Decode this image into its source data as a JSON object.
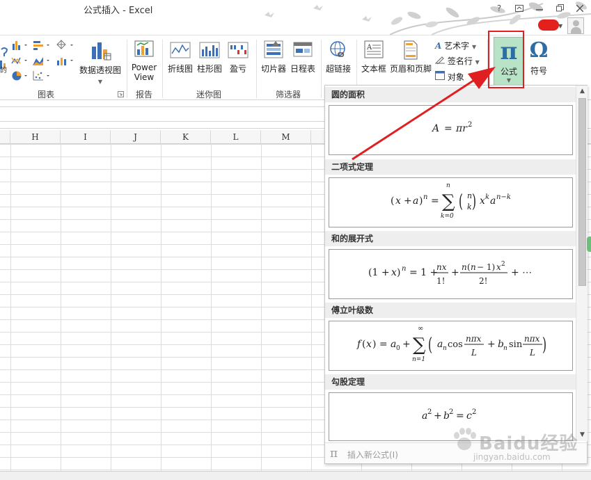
{
  "window": {
    "title": "公式插入 - Excel",
    "help": "?",
    "left_stub": "的"
  },
  "ribbon": {
    "groups": {
      "charts": "图表",
      "reports": "报告",
      "sparklines": "迷你图",
      "filters": "筛选器"
    },
    "buttons": {
      "pivot_chart": "数据透视图",
      "power_view_1": "Power",
      "power_view_2": "View",
      "line": "折线图",
      "column": "柱形图",
      "win_loss": "盈亏",
      "slicer": "切片器",
      "timeline": "日程表",
      "hyperlink": "超链接",
      "text_box": "文本框",
      "header_footer": "页眉和页脚",
      "wordart": "艺术字",
      "signature": "签名行",
      "object": "对象",
      "equation": "公式",
      "symbol": "符号"
    }
  },
  "sheet": {
    "columns": [
      "H",
      "I",
      "J",
      "K",
      "L",
      "M"
    ]
  },
  "gallery": {
    "sections": [
      {
        "title": "圆的面积",
        "formula": "A = πr²"
      },
      {
        "title": "二项式定理",
        "formula": "(x + a)ⁿ = Σ_{k=0}^{n} (n k) xᵏ aⁿ⁻ᵏ"
      },
      {
        "title": "和的展开式",
        "formula": "(1 + x)ⁿ = 1 + nx/1! + n(n − 1)x²/2! + ⋯"
      },
      {
        "title": "傅立叶级数",
        "formula": "f(x) = a₀ + Σ_{n=1}^{∞} (aₙ cos nπx/L + bₙ sin nπx/L)"
      },
      {
        "title": "勾股定理",
        "formula": "a² + b² = c²"
      }
    ],
    "insert_new": "插入新公式(I)"
  },
  "watermark": {
    "brand": "Baidu经验",
    "url": "jingyan.baidu.com"
  },
  "colors": {
    "highlight": "#e02020",
    "equation_button_bg": "#b9e3c6"
  }
}
